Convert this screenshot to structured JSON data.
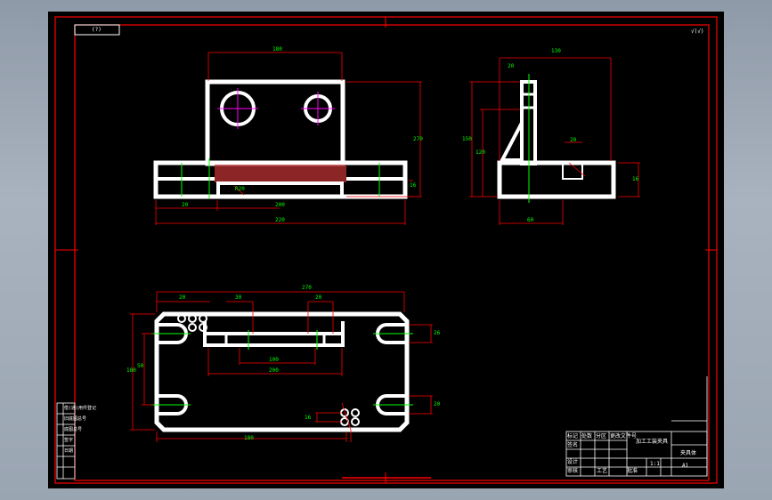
{
  "sheet": {
    "tag_text": "(?)",
    "roughness": "√(√)",
    "part_title": "加工工装夹具",
    "part_subtitle": "夹具体",
    "drawing_no": "A1",
    "scale": "1:1",
    "colors": {
      "background": "#000000",
      "part": "#ffffff",
      "dimension": "#ff0000",
      "center": "#ff00ff",
      "text": "#00ff00"
    }
  },
  "front_view": {
    "dims": [
      "180",
      "270",
      "16",
      "R20",
      "20",
      "200",
      "220",
      "20"
    ]
  },
  "side_view": {
    "dims": [
      "130",
      "20",
      "60",
      "150",
      "120",
      "20",
      "16"
    ]
  },
  "top_view": {
    "dims": [
      "180",
      "20",
      "18",
      "30",
      "200",
      "40",
      "20",
      "26",
      "20",
      "100",
      "270",
      "180",
      "50",
      "16"
    ]
  },
  "title_block": {
    "rows": [
      "标记",
      "处数",
      "分区",
      "更改文件号",
      "签名"
    ],
    "labels": [
      "设计",
      "审核",
      "工艺",
      "批准"
    ]
  },
  "side_table": {
    "rows": [
      "借(通)用件登记",
      "旧底图总号",
      "底图总号",
      "签字",
      "日期"
    ]
  }
}
